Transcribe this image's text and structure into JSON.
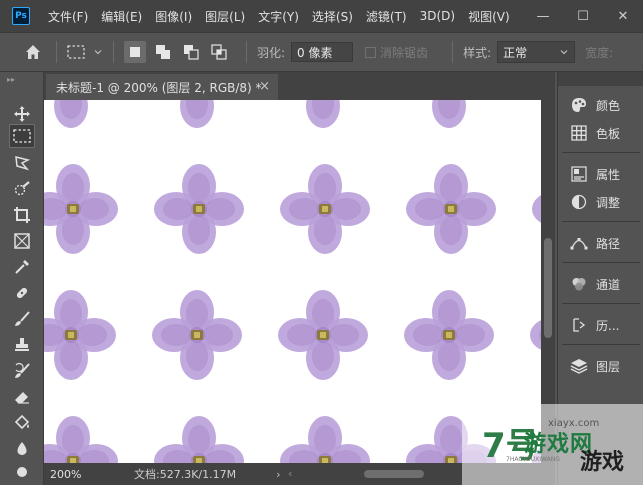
{
  "app": {
    "logo": "Ps"
  },
  "menu": [
    "文件(F)",
    "编辑(E)",
    "图像(I)",
    "图层(L)",
    "文字(Y)",
    "选择(S)",
    "滤镜(T)",
    "3D(D)",
    "视图(V)"
  ],
  "window_controls": {
    "minimize": "—",
    "maximize": "☐",
    "close": "✕"
  },
  "options": {
    "feather_label": "羽化:",
    "feather_value": "0 像素",
    "antialias_label": "消除锯齿",
    "style_label": "样式:",
    "style_value": "正常",
    "width_label": "宽度:"
  },
  "document": {
    "tab_title": "未标题-1 @ 200% (图层 2, RGB/8) *",
    "close_label": "×",
    "zoom": "200%",
    "doc_info": "文档:527.3K/1.17M",
    "status_arrow": "›",
    "scroll_left": "‹"
  },
  "tools": [
    "move-tool",
    "rect-marquee-tool",
    "lasso-tool",
    "quick-select-tool",
    "crop-tool",
    "frame-tool",
    "eyedropper-tool",
    "healing-brush-tool",
    "brush-tool",
    "clone-stamp-tool",
    "history-brush-tool",
    "eraser-tool",
    "paint-bucket-tool",
    "blur-tool",
    "dodge-tool"
  ],
  "panels": [
    {
      "label": "颜色",
      "icon": "color-palette-icon"
    },
    {
      "label": "色板",
      "icon": "swatches-grid-icon"
    },
    {
      "label": "属性",
      "icon": "properties-icon"
    },
    {
      "label": "调整",
      "icon": "adjustments-icon"
    },
    {
      "label": "路径",
      "icon": "paths-icon"
    },
    {
      "label": "通道",
      "icon": "channels-icon"
    },
    {
      "label": "历...",
      "icon": "history-icon"
    },
    {
      "label": "图层",
      "icon": "layers-icon"
    }
  ],
  "watermark": {
    "site": "xiayx.com",
    "number": "7号",
    "text_top": "游戏网",
    "pinyin": "7HAOYOUXIWANG",
    "text_bottom": "游戏"
  },
  "colors": {
    "flower_petal": "#b9a0d8",
    "flower_petal_dark": "#9d7cc4",
    "flower_center": "#8b7a3a",
    "canvas_bg": "#ffffff",
    "ui_dark": "#424242",
    "ui_mid": "#535353"
  }
}
